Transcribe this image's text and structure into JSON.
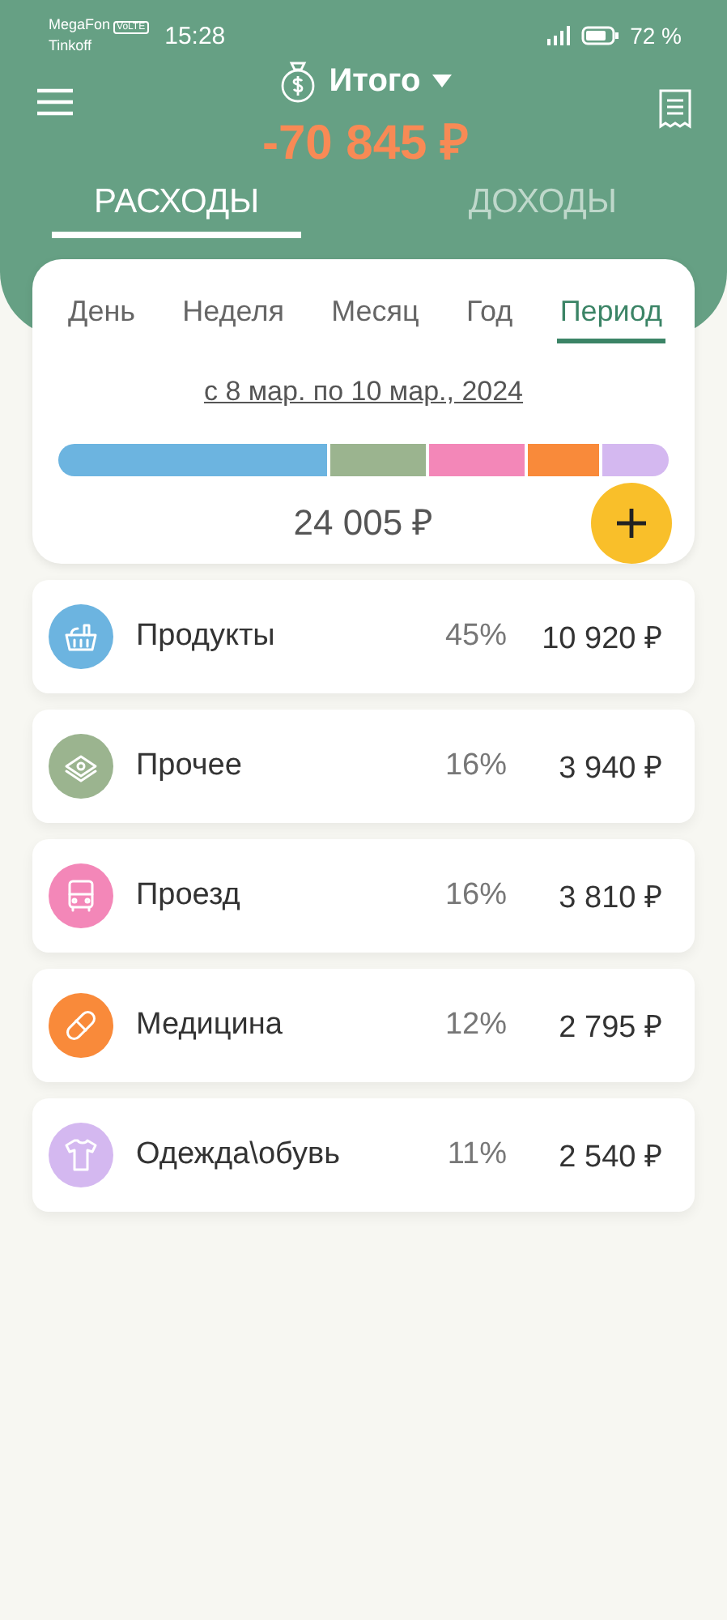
{
  "status_bar": {
    "carrier": "MegaFon",
    "volte": "VoLTE",
    "carrier_2": "Tinkoff",
    "time": "15:28",
    "battery": "72 %"
  },
  "header": {
    "account": "Итого",
    "total": "-70 845 ₽"
  },
  "tabs": [
    {
      "label": "РАСХОДЫ",
      "selected": true
    },
    {
      "label": "ДОХОДЫ",
      "selected": false
    }
  ],
  "periods": [
    {
      "label": "День",
      "selected": false
    },
    {
      "label": "Неделя",
      "selected": false
    },
    {
      "label": "Месяц",
      "selected": false
    },
    {
      "label": "Год",
      "selected": false
    },
    {
      "label": "Период",
      "selected": true
    }
  ],
  "date_range": "с 8 мар. по 10 мар., 2024",
  "sum": "24 005 ₽",
  "categories": [
    {
      "kind": "basket",
      "name": "Продукты",
      "percent": "45%",
      "amount": "10 920 ₽",
      "color": "#6cb4e0"
    },
    {
      "kind": "money",
      "name": "Прочее",
      "percent": "16%",
      "amount": "3 940 ₽",
      "color": "#9bb48f"
    },
    {
      "kind": "bus",
      "name": "Проезд",
      "percent": "16%",
      "amount": "3 810 ₽",
      "color": "#f387b8"
    },
    {
      "kind": "pill",
      "name": "Медицина",
      "percent": "12%",
      "amount": "2 795 ₽",
      "color": "#f98a3a"
    },
    {
      "kind": "shirt",
      "name": "Одежда\\обувь",
      "percent": "11%",
      "amount": "2 540 ₽",
      "color": "#d4b8f0"
    }
  ]
}
